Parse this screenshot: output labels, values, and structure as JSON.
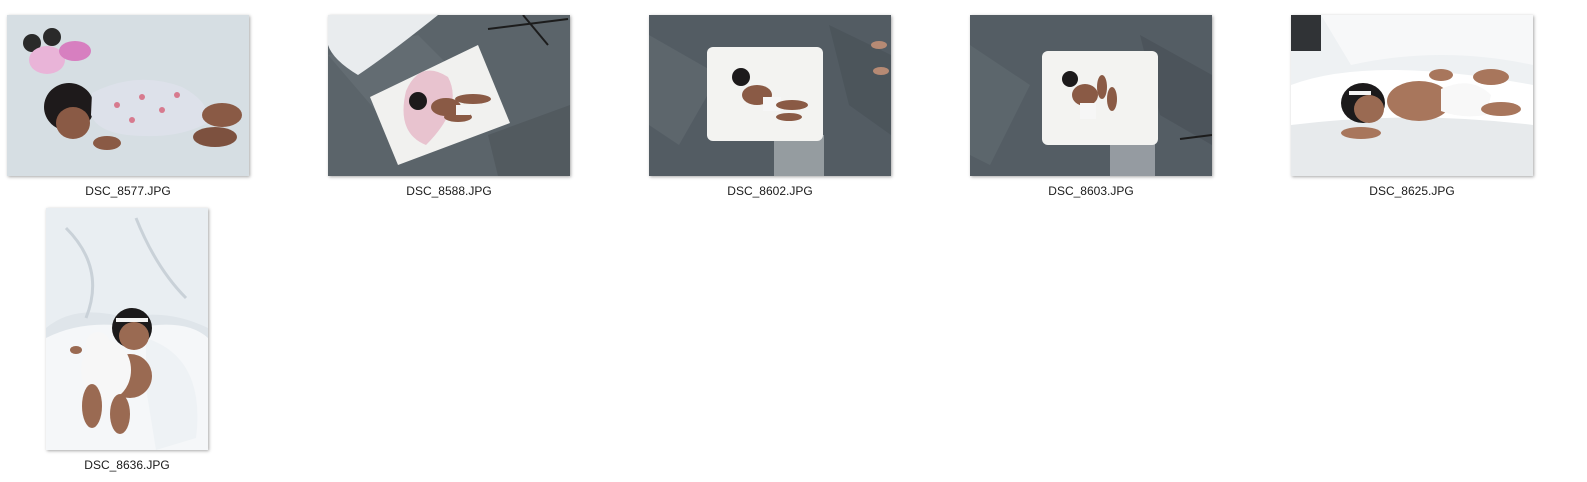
{
  "window": {
    "view": "Large icons"
  },
  "files": [
    {
      "name": "DSC_8577.JPG",
      "thumbnail": "baby-sleeping-with-minnie-toy"
    },
    {
      "name": "DSC_8588.JPG",
      "thumbnail": "baby-on-heart-pillow-marble-floor"
    },
    {
      "name": "DSC_8602.JPG",
      "thumbnail": "baby-on-white-cushion-marble-floor"
    },
    {
      "name": "DSC_8603.JPG",
      "thumbnail": "baby-on-white-cushion-marble-floor-closeup"
    },
    {
      "name": "DSC_8625.JPG",
      "thumbnail": "baby-lying-on-white-blanket"
    },
    {
      "name": "DSC_8636.JPG",
      "thumbnail": "baby-sitting-with-white-teddy"
    }
  ]
}
